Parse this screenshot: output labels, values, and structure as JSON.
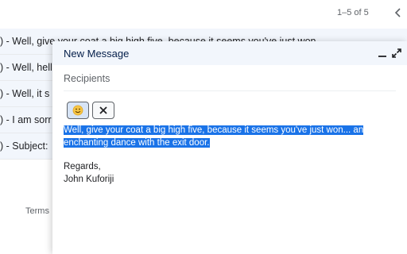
{
  "pager": {
    "range": "1–5 of 5"
  },
  "inbox": {
    "rows": [
      ") - Well, give your coat a big high five, because it seems you've just won",
      ") - Well, hell",
      ") - Well, it s",
      ") - I am sorr",
      ") - Subject:"
    ]
  },
  "footer": {
    "terms": "Terms"
  },
  "compose": {
    "title": "New Message",
    "recipients_placeholder": "Recipients",
    "toolbar": {
      "emoji_icon": "smiley-icon",
      "close_icon": "close-icon"
    },
    "body": {
      "selected_line1": "Well, give your coat a big high five, because it seems you've just won... an",
      "selected_line2": "enchanting dance with the exit door.",
      "signoff": "Regards,",
      "name": "John Kuforiji"
    }
  },
  "colors": {
    "selection": "#1a73e8",
    "header_bg": "#f2f6fc"
  }
}
